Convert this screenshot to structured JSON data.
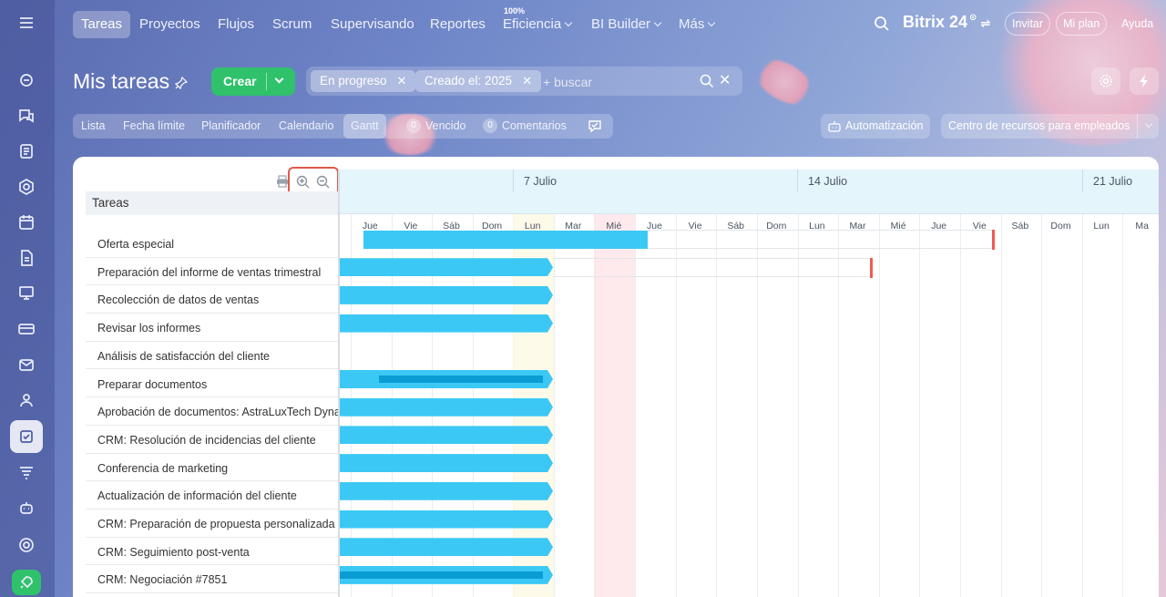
{
  "colors": {
    "accent_green": "#2fc26b",
    "bar_blue": "#3bc8f5",
    "progress_blue": "#0a9dd4",
    "deadline_red": "#f15b50",
    "highlight_red": "#e05a4c"
  },
  "topnav": {
    "items": [
      "Tareas",
      "Proyectos",
      "Flujos",
      "Scrum",
      "Supervisando",
      "Reportes",
      "Eficiencia",
      "BI Builder",
      "Más"
    ],
    "efficiency_badge": "100%",
    "brand": "Bitrix 24",
    "invite": "Invitar",
    "my_plan": "Mi plan",
    "help": "Ayuda"
  },
  "header": {
    "title": "Mis tareas",
    "create_label": "Crear",
    "filters": [
      "En progreso",
      "Creado el: 2025"
    ],
    "search_placeholder": "+ buscar"
  },
  "viewtabs": {
    "items": [
      "Lista",
      "Fecha límite",
      "Planificador",
      "Calendario",
      "Gantt"
    ],
    "overdue_count": "0",
    "overdue_label": "Vencido",
    "comments_count": "0",
    "comments_label": "Comentarios"
  },
  "right_buttons": {
    "automation": "Automatización",
    "resource_center": "Centro de recursos para empleados"
  },
  "gantt": {
    "tasks_header": "Tareas",
    "weeks": [
      "7 Julio",
      "14 Julio",
      "21 Julio"
    ],
    "days": [
      "Jue",
      "Vie",
      "Sáb",
      "Dom",
      "Lun",
      "Mar",
      "Mié",
      "Jue",
      "Vie",
      "Sáb",
      "Dom",
      "Lun",
      "Mar",
      "Mié",
      "Jue",
      "Vie",
      "Sáb",
      "Dom",
      "Lun",
      "Ma"
    ],
    "tasks": [
      "Oferta especial",
      "Preparación del informe de ventas trimestral",
      "Recolección de datos de ventas",
      "Revisar los informes",
      "Análisis de satisfacción del cliente",
      "Preparar documentos",
      "Aprobación de documentos: AstraLuxTech Dynamics",
      "CRM: Resolución de incidencias del cliente",
      "Conferencia de marketing",
      "Actualización de información del cliente",
      "CRM: Preparación de propuesta personalizada",
      "CRM: Seguimiento post-venta",
      "CRM: Negociación #7851"
    ]
  }
}
